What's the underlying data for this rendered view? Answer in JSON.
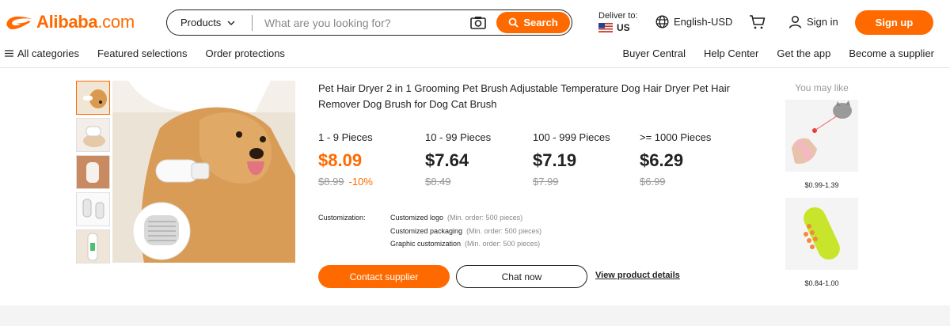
{
  "header": {
    "logo_text": "Alibaba",
    "logo_suffix": ".com",
    "search": {
      "category": "Products",
      "placeholder": "What are you looking for?",
      "button_label": "Search"
    },
    "deliver": {
      "label": "Deliver to:",
      "country": "US"
    },
    "language": "English-USD",
    "signin": "Sign in",
    "signup": "Sign up"
  },
  "nav": {
    "left": [
      "All categories",
      "Featured selections",
      "Order protections"
    ],
    "right": [
      "Buyer Central",
      "Help Center",
      "Get the app",
      "Become a supplier"
    ]
  },
  "product": {
    "title": "Pet Hair Dryer 2 in 1 Grooming Pet Brush Adjustable Temperature Dog Hair Dryer Pet Hair Remover Dog Brush for Dog Cat Brush",
    "tiers": [
      {
        "qty": "1 - 9 Pieces",
        "price": "$8.09",
        "old": "$8.99",
        "discount": "-10%"
      },
      {
        "qty": "10 - 99 Pieces",
        "price": "$7.64",
        "old": "$8.49",
        "discount": ""
      },
      {
        "qty": "100 - 999 Pieces",
        "price": "$7.19",
        "old": "$7.99",
        "discount": ""
      },
      {
        "qty": ">= 1000 Pieces",
        "price": "$6.29",
        "old": "$6.99",
        "discount": ""
      }
    ],
    "customization": {
      "label": "Customization:",
      "items": [
        {
          "name": "Customized logo",
          "min": "(Min. order: 500 pieces)"
        },
        {
          "name": "Customized packaging",
          "min": "(Min. order: 500 pieces)"
        },
        {
          "name": "Graphic customization",
          "min": "(Min. order: 500 pieces)"
        }
      ]
    },
    "contact_label": "Contact supplier",
    "chat_label": "Chat now",
    "details_label": "View product details"
  },
  "you_may_like": {
    "title": "You may like",
    "items": [
      {
        "price": "$0.99-1.39",
        "icon": "laser-toy-image"
      },
      {
        "price": "$0.84-1.00",
        "icon": "steam-brush-image"
      }
    ]
  },
  "colors": {
    "accent": "#ff6a00",
    "text": "#222222",
    "muted": "#999999"
  }
}
